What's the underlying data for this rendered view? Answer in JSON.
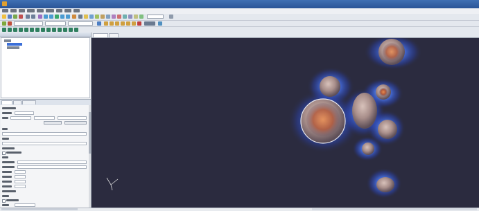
{
  "window": {
    "title": "",
    "icon": "paraview-app-icon"
  },
  "menubar": {
    "items": [
      "",
      "",
      "",
      "",
      "",
      "",
      "",
      "",
      ""
    ]
  },
  "pipeline_browser": {
    "header": "",
    "tree_items": [
      {
        "label": "",
        "icon": "server-icon"
      },
      {
        "label": "",
        "icon": "dataset-icon",
        "selected": true
      },
      {
        "label": "",
        "icon": "filter-icon"
      }
    ]
  },
  "properties_panel": {
    "tabs": [
      "",
      "",
      ""
    ],
    "active_tab": 0
  },
  "view": {
    "tabs": [
      "",
      ""
    ],
    "background_color": "#2b2b3f",
    "orientation_axes": {
      "x": "",
      "y": "",
      "z": ""
    }
  },
  "colors": {
    "accent": "#3b6fd8",
    "glow": "#4c7dff",
    "particle_fill": "#b8a09a",
    "particle_core": "#d27a4e"
  }
}
